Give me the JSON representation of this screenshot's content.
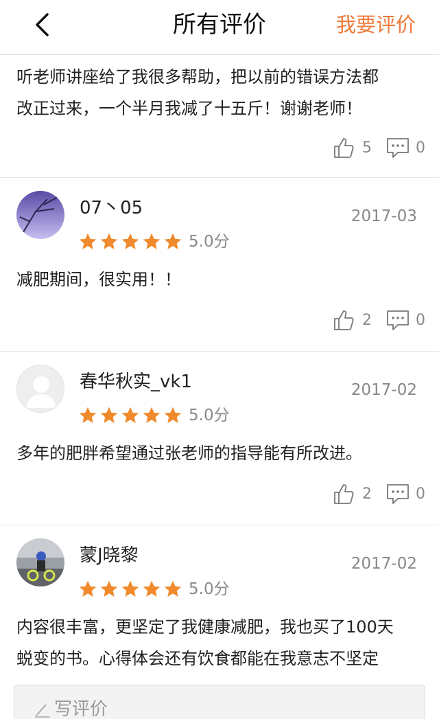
{
  "header": {
    "title": "所有评价",
    "write_review": "我要评价"
  },
  "colors": {
    "accent": "#ee7a3a",
    "star": "#f08a2c",
    "text": "#222222",
    "muted": "#888888"
  },
  "first_review": {
    "content_lines": [
      "听老师讲座给了我很多帮助，把以前的错误方法都",
      "改正过来，一个半月我减了十五斤！谢谢老师！"
    ],
    "likes": "5",
    "comments": "0"
  },
  "reviews": [
    {
      "username": "07丶05",
      "date": "2017-03",
      "rating": 5,
      "score": "5.0分",
      "avatar": "purple-sky-photo",
      "content_lines": [
        "减肥期间，很实用！！"
      ],
      "likes": "2",
      "comments": "0"
    },
    {
      "username": "春华秋实_vk1",
      "date": "2017-02",
      "rating": 5,
      "score": "5.0分",
      "avatar": "default-user",
      "content_lines": [
        "多年的肥胖希望通过张老师的指导能有所改进。"
      ],
      "likes": "2",
      "comments": "0"
    },
    {
      "username": "蒙J晓黎",
      "date": "2017-02",
      "rating": 5,
      "score": "5.0分",
      "avatar": "child-bike-photo",
      "content_lines": [
        "内容很丰富，更坚定了我健康减肥，我也买了100天",
        "蜕变的书。心得体会还有饮食都能在我意志不坚定"
      ]
    }
  ],
  "footer": {
    "write_placeholder": "写评价"
  }
}
